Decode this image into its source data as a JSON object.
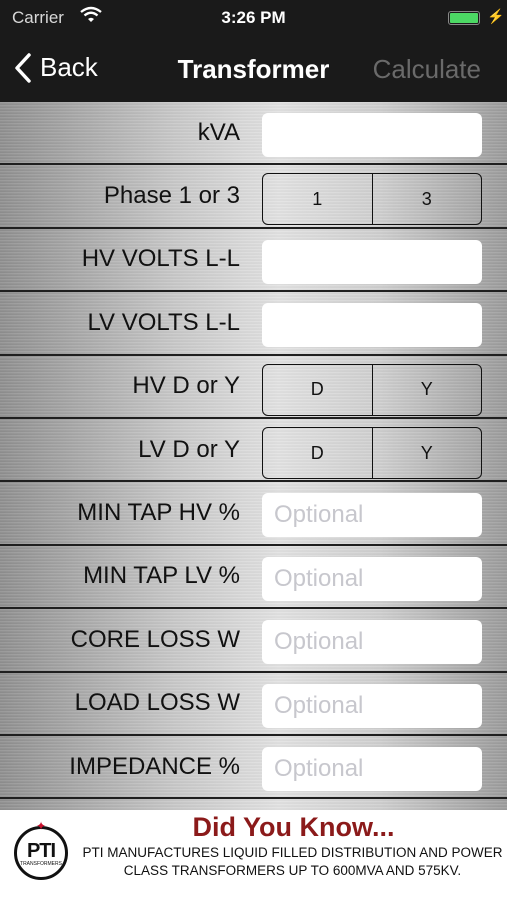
{
  "status_bar": {
    "carrier": "Carrier",
    "time": "3:26 PM"
  },
  "nav": {
    "back_label": "Back",
    "title": "Transformer",
    "calculate_label": "Calculate"
  },
  "form": {
    "kva": {
      "label": "kVA",
      "value": "",
      "placeholder": ""
    },
    "phase": {
      "label": "Phase 1 or 3",
      "options": [
        "1",
        "3"
      ]
    },
    "hv_volts": {
      "label": "HV VOLTS L-L",
      "value": "",
      "placeholder": ""
    },
    "lv_volts": {
      "label": "LV VOLTS L-L",
      "value": "",
      "placeholder": ""
    },
    "hv_connection": {
      "label": "HV D or Y",
      "options": [
        "D",
        "Y"
      ]
    },
    "lv_connection": {
      "label": "LV D or Y",
      "options": [
        "D",
        "Y"
      ]
    },
    "min_tap_hv": {
      "label": "MIN TAP HV %",
      "value": "",
      "placeholder": "Optional"
    },
    "min_tap_lv": {
      "label": "MIN TAP LV %",
      "value": "",
      "placeholder": "Optional"
    },
    "core_loss": {
      "label": "CORE LOSS W",
      "value": "",
      "placeholder": "Optional"
    },
    "load_loss": {
      "label": "LOAD LOSS W",
      "value": "",
      "placeholder": "Optional"
    },
    "impedance": {
      "label": "IMPEDANCE %",
      "value": "",
      "placeholder": "Optional"
    }
  },
  "ad": {
    "logo_text": "PTI",
    "logo_subtext": "TRANSFORMERS",
    "headline": "Did You Know...",
    "body": "PTI MANUFACTURES LIQUID FILLED DISTRIBUTION AND POWER CLASS TRANSFORMERS UP TO 600MVA AND 575KV."
  },
  "colors": {
    "battery": "#4cd964",
    "headline": "#8b1a1a",
    "nav_bg": "#1a1a1a"
  }
}
